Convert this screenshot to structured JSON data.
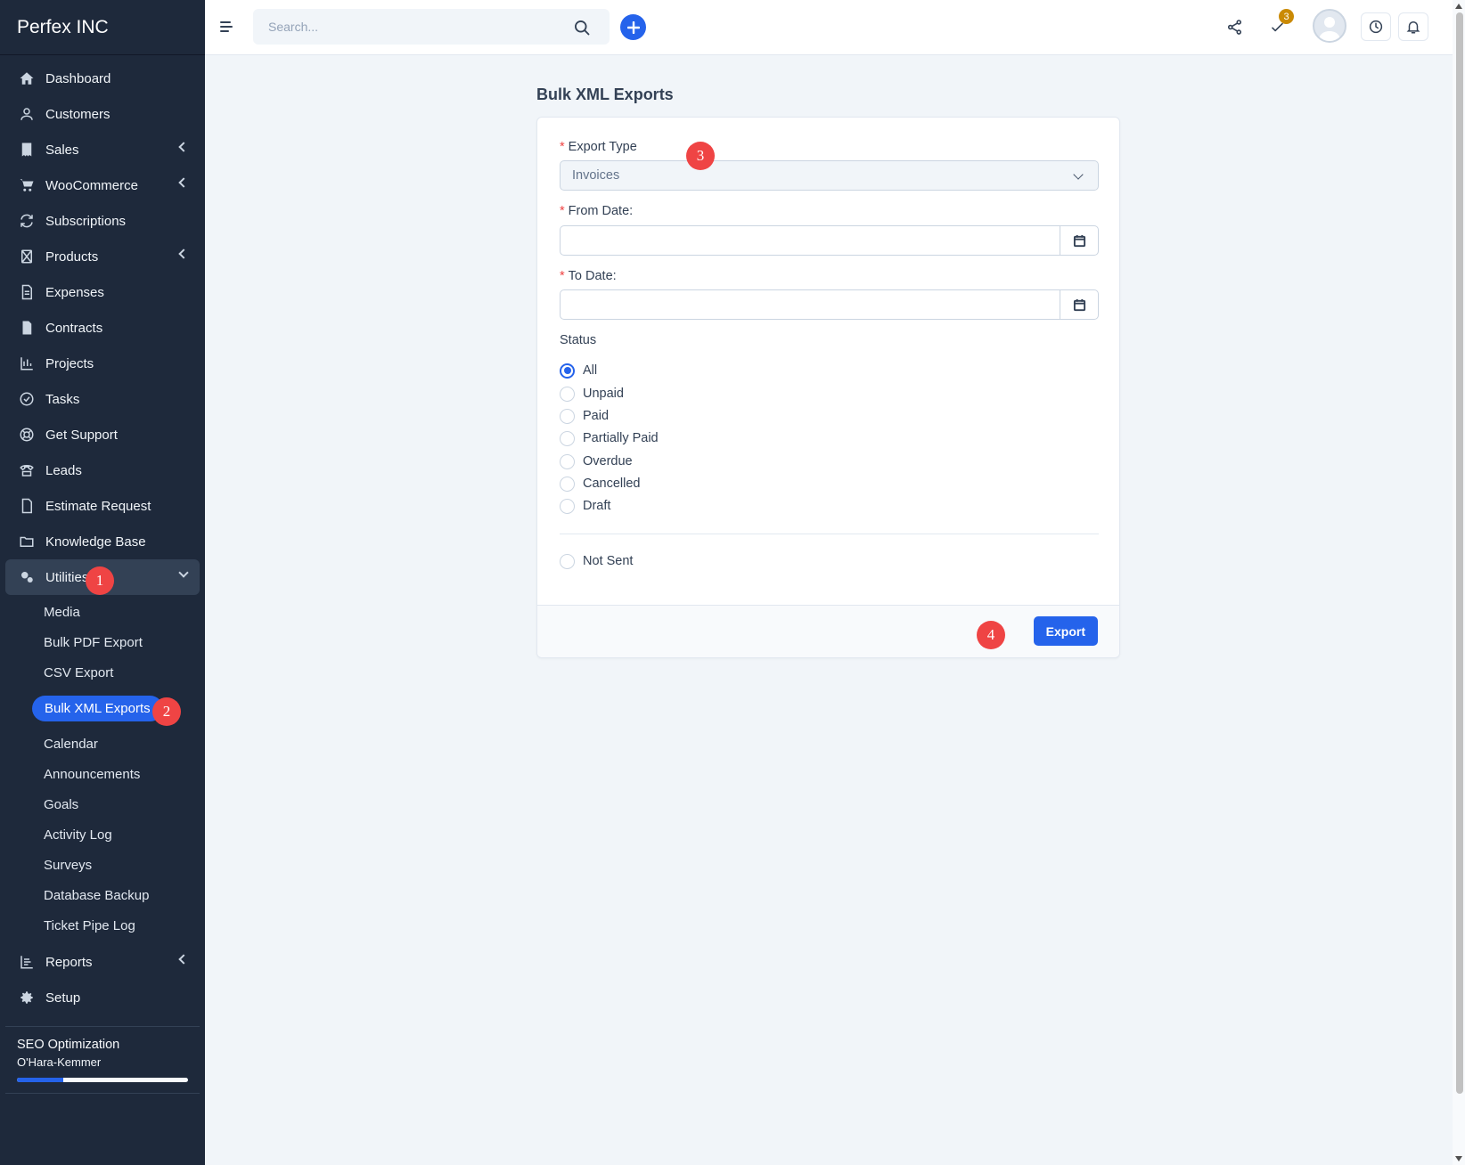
{
  "brand": "Perfex INC",
  "sidebar": {
    "items": [
      {
        "label": "Dashboard",
        "icon": "home-icon"
      },
      {
        "label": "Customers",
        "icon": "user-icon"
      },
      {
        "label": "Sales",
        "icon": "receipt-icon"
      },
      {
        "label": "WooCommerce",
        "icon": "cart-icon"
      },
      {
        "label": "Subscriptions",
        "icon": "repeat-icon"
      },
      {
        "label": "Products",
        "icon": "box-icon"
      },
      {
        "label": "Expenses",
        "icon": "file-text-icon"
      },
      {
        "label": "Contracts",
        "icon": "contract-icon"
      },
      {
        "label": "Projects",
        "icon": "chart-icon"
      },
      {
        "label": "Tasks",
        "icon": "check-circle-icon"
      },
      {
        "label": "Get Support",
        "icon": "lifebuoy-icon"
      },
      {
        "label": "Leads",
        "icon": "tty-icon"
      },
      {
        "label": "Estimate Request",
        "icon": "file-icon"
      },
      {
        "label": "Knowledge Base",
        "icon": "folder-icon"
      },
      {
        "label": "Utilities",
        "icon": "cogs-icon"
      },
      {
        "label": "Reports",
        "icon": "bar-chart-icon"
      },
      {
        "label": "Setup",
        "icon": "gear-icon"
      }
    ],
    "utilities_sub": [
      "Media",
      "Bulk PDF Export",
      "CSV Export",
      "Bulk XML Exports",
      "Calendar",
      "Announcements",
      "Goals",
      "Activity Log",
      "Surveys",
      "Database Backup",
      "Ticket Pipe Log"
    ],
    "project": {
      "name": "SEO Optimization",
      "client": "O'Hara-Kemmer",
      "progress": 0.27
    }
  },
  "markers": [
    "1",
    "2",
    "3",
    "4"
  ],
  "topbar": {
    "search_placeholder": "Search...",
    "todo_count": "3"
  },
  "page": {
    "title": "Bulk XML Exports",
    "export_type_label": "Export Type",
    "export_type_value": "Invoices",
    "from_date_label": "From Date:",
    "to_date_label": "To Date:",
    "required_mark": "*",
    "status_label": "Status",
    "statuses": [
      "All",
      "Unpaid",
      "Paid",
      "Partially Paid",
      "Overdue",
      "Cancelled",
      "Draft"
    ],
    "selected_status": "All",
    "not_sent_label": "Not Sent",
    "export_button": "Export"
  }
}
